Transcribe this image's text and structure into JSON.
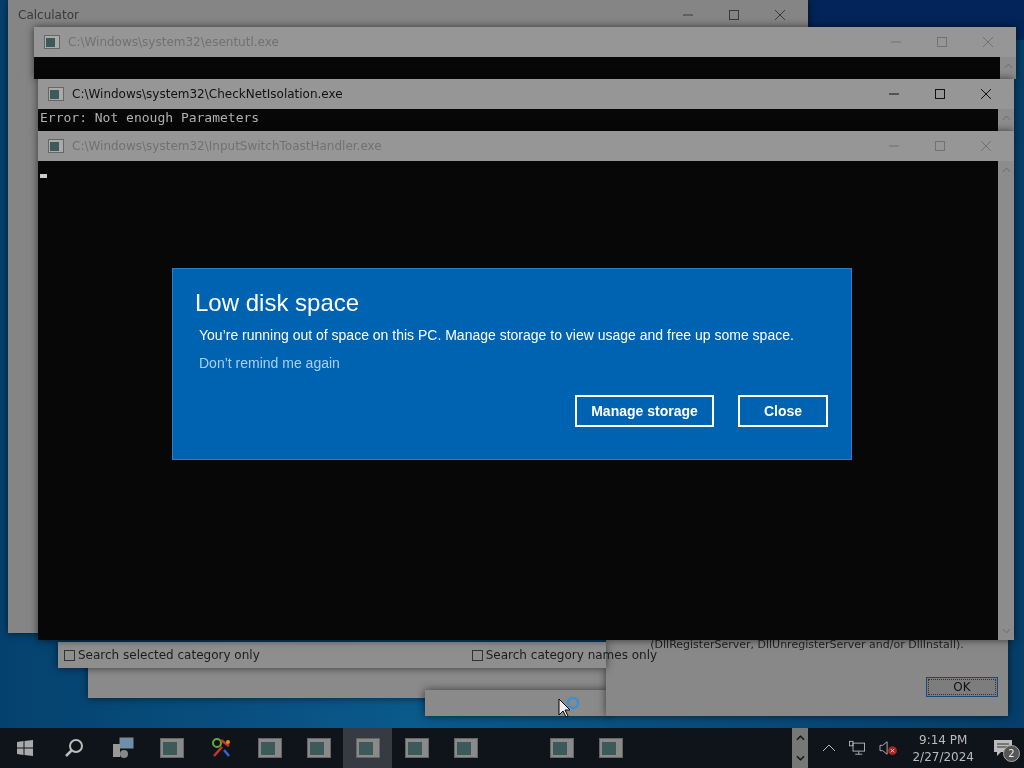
{
  "windows": [
    {
      "title": "Calculator",
      "active": false
    },
    {
      "title": "C:\\Windows\\system32\\esentutl.exe",
      "active": false
    },
    {
      "title": "C:\\Windows\\system32\\CheckNetIsolation.exe",
      "active": true,
      "console_line": "Error: Not enough Parameters"
    },
    {
      "title": "C:\\Windows\\system32\\InputSwitchToastHandler.exe",
      "active": false
    }
  ],
  "search_options": [
    {
      "label": "Search selected category only",
      "checked": false
    },
    {
      "label": "Search category names only",
      "checked": false
    }
  ],
  "message_box": {
    "text": "(DllRegisterServer, DllUnregisterServer and/or DllInstall).",
    "button": "OK"
  },
  "toast": {
    "title": "Low disk space",
    "body": "You’re running out of space on this PC. Manage storage to view usage and free up some space.",
    "link": "Don’t remind me again",
    "buttons": [
      "Manage storage",
      "Close"
    ]
  },
  "taskbar": {
    "items": [
      {
        "kind": "start",
        "selected": false
      },
      {
        "kind": "search",
        "selected": false
      },
      {
        "kind": "tool",
        "selected": false
      },
      {
        "kind": "console",
        "selected": false
      },
      {
        "kind": "app",
        "selected": false
      },
      {
        "kind": "console",
        "selected": false
      },
      {
        "kind": "console",
        "selected": false
      },
      {
        "kind": "console",
        "selected": true
      },
      {
        "kind": "console",
        "selected": false
      },
      {
        "kind": "console",
        "selected": false
      },
      {
        "kind": "console",
        "selected": false
      },
      {
        "kind": "console",
        "selected": false
      }
    ],
    "time": "9:14 PM",
    "date": "2/27/2024",
    "notifications": "2"
  }
}
